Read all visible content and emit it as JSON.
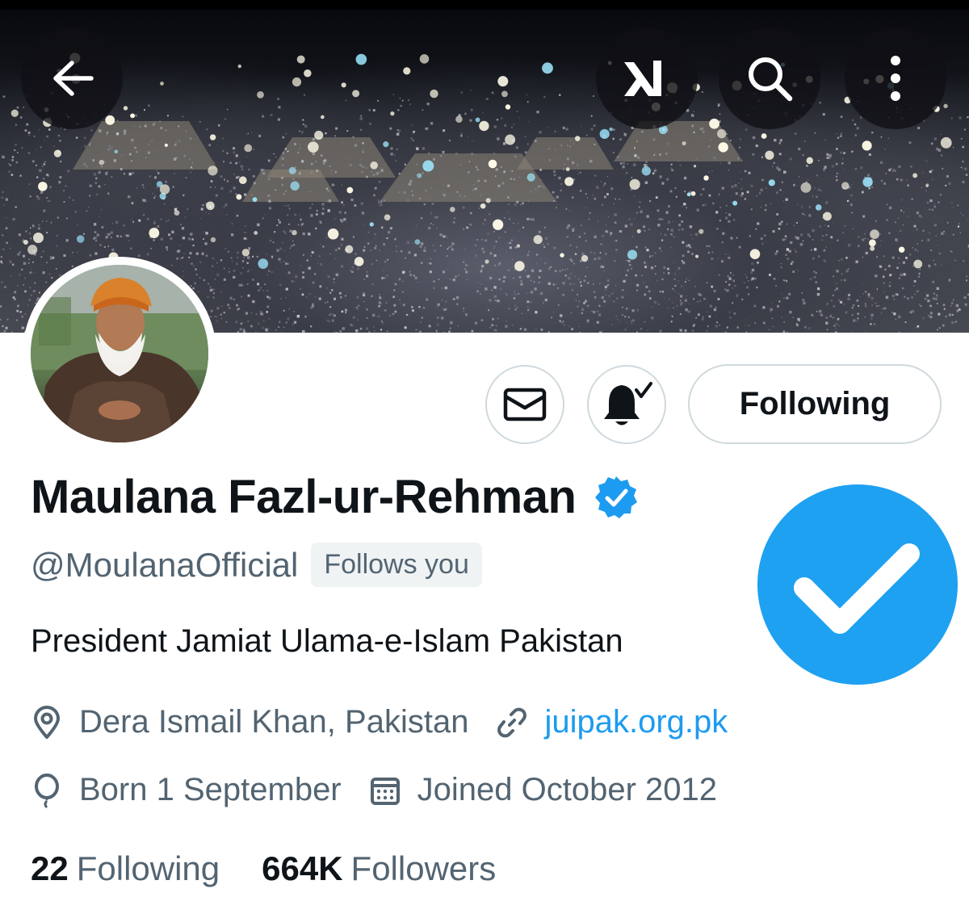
{
  "header": {
    "back_icon": "back-arrow-icon",
    "grok_icon": "grok-icon",
    "search_icon": "search-icon",
    "more_icon": "more-vertical-icon"
  },
  "actions": {
    "message_icon": "mail-icon",
    "notify_icon": "bell-check-icon",
    "following_label": "Following"
  },
  "profile": {
    "name": "Maulana Fazl-ur-Rehman",
    "verified": true,
    "handle": "@MoulanaOfficial",
    "follows_you": "Follows you",
    "bio": "President Jamiat Ulama-e-Islam Pakistan",
    "location": "Dera Ismail Khan, Pakistan",
    "website": "juipak.org.pk",
    "birthday": "Born 1 September",
    "joined": "Joined October 2012"
  },
  "stats": {
    "following_count": "22",
    "following_label": "Following",
    "followers_count": "664K",
    "followers_label": "Followers"
  },
  "colors": {
    "accent": "#1d9bf0",
    "text_primary": "#0f1419",
    "text_secondary": "#536471",
    "border": "#cfd9de",
    "badge_bg": "#eff3f4"
  }
}
